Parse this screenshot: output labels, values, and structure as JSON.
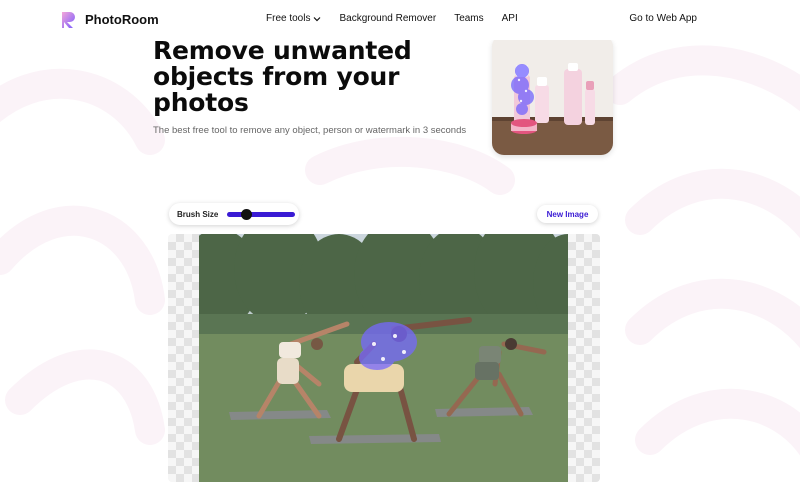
{
  "brand": {
    "name": "PhotoRoom",
    "accent": "#3a1bd4",
    "logo_gradient": [
      "#f4a7d9",
      "#7b5cff"
    ]
  },
  "nav": {
    "items": [
      {
        "label": "Free tools",
        "has_dropdown": true,
        "icon": "chevron-down-icon"
      },
      {
        "label": "Background Remover"
      },
      {
        "label": "Teams"
      },
      {
        "label": "API"
      }
    ],
    "cta": "Go to Web App"
  },
  "hero": {
    "title": "Remove unwanted objects from your photos",
    "subtitle": "The best free tool to remove any object, person or watermark in 3 seconds"
  },
  "editor": {
    "brush_label": "Brush Size",
    "brush_size_fraction": 0.24,
    "new_image_label": "New Image"
  }
}
